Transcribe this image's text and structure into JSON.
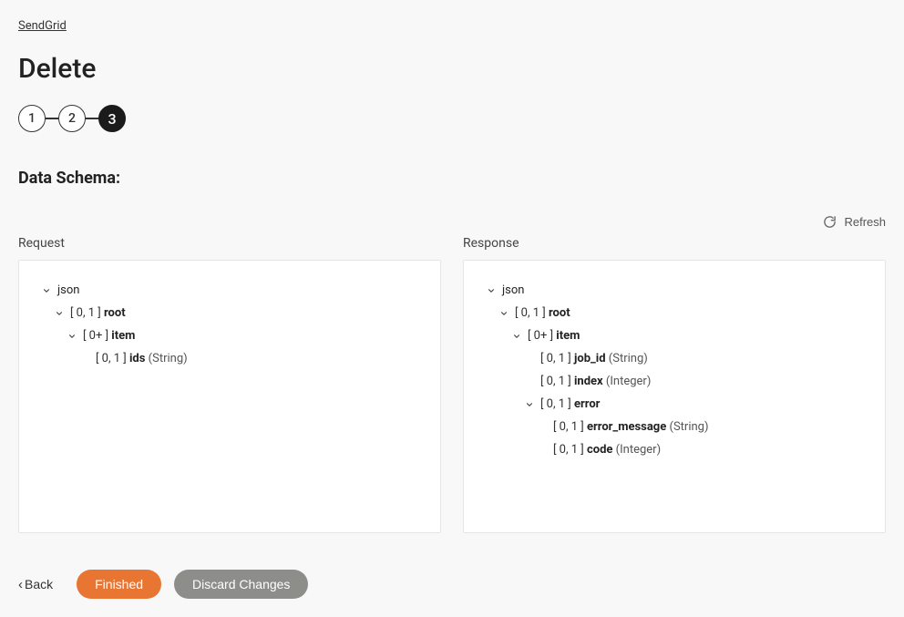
{
  "breadcrumb": "SendGrid",
  "page_title": "Delete",
  "stepper": {
    "steps": [
      "1",
      "2",
      "3"
    ],
    "active_index": 2
  },
  "section_title": "Data Schema:",
  "refresh_label": "Refresh",
  "request": {
    "title": "Request",
    "tree": [
      {
        "indent": 0,
        "expandable": true,
        "cardinality": "",
        "name": "json",
        "type": ""
      },
      {
        "indent": 1,
        "expandable": true,
        "cardinality": "[ 0, 1 ]",
        "name": "root",
        "type": ""
      },
      {
        "indent": 2,
        "expandable": true,
        "cardinality": "[ 0+ ]",
        "name": "item",
        "type": ""
      },
      {
        "indent": 3,
        "expandable": false,
        "cardinality": "[ 0, 1 ]",
        "name": "ids",
        "type": "(String)"
      }
    ]
  },
  "response": {
    "title": "Response",
    "tree": [
      {
        "indent": 0,
        "expandable": true,
        "cardinality": "",
        "name": "json",
        "type": ""
      },
      {
        "indent": 1,
        "expandable": true,
        "cardinality": "[ 0, 1 ]",
        "name": "root",
        "type": ""
      },
      {
        "indent": 2,
        "expandable": true,
        "cardinality": "[ 0+ ]",
        "name": "item",
        "type": ""
      },
      {
        "indent": 3,
        "expandable": false,
        "cardinality": "[ 0, 1 ]",
        "name": "job_id",
        "type": "(String)"
      },
      {
        "indent": 3,
        "expandable": false,
        "cardinality": "[ 0, 1 ]",
        "name": "index",
        "type": "(Integer)"
      },
      {
        "indent": 3,
        "expandable": true,
        "cardinality": "[ 0, 1 ]",
        "name": "error",
        "type": ""
      },
      {
        "indent": 4,
        "expandable": false,
        "cardinality": "[ 0, 1 ]",
        "name": "error_message",
        "type": "(String)"
      },
      {
        "indent": 4,
        "expandable": false,
        "cardinality": "[ 0, 1 ]",
        "name": "code",
        "type": "(Integer)"
      }
    ]
  },
  "footer": {
    "back": "Back",
    "finished": "Finished",
    "discard": "Discard Changes"
  }
}
